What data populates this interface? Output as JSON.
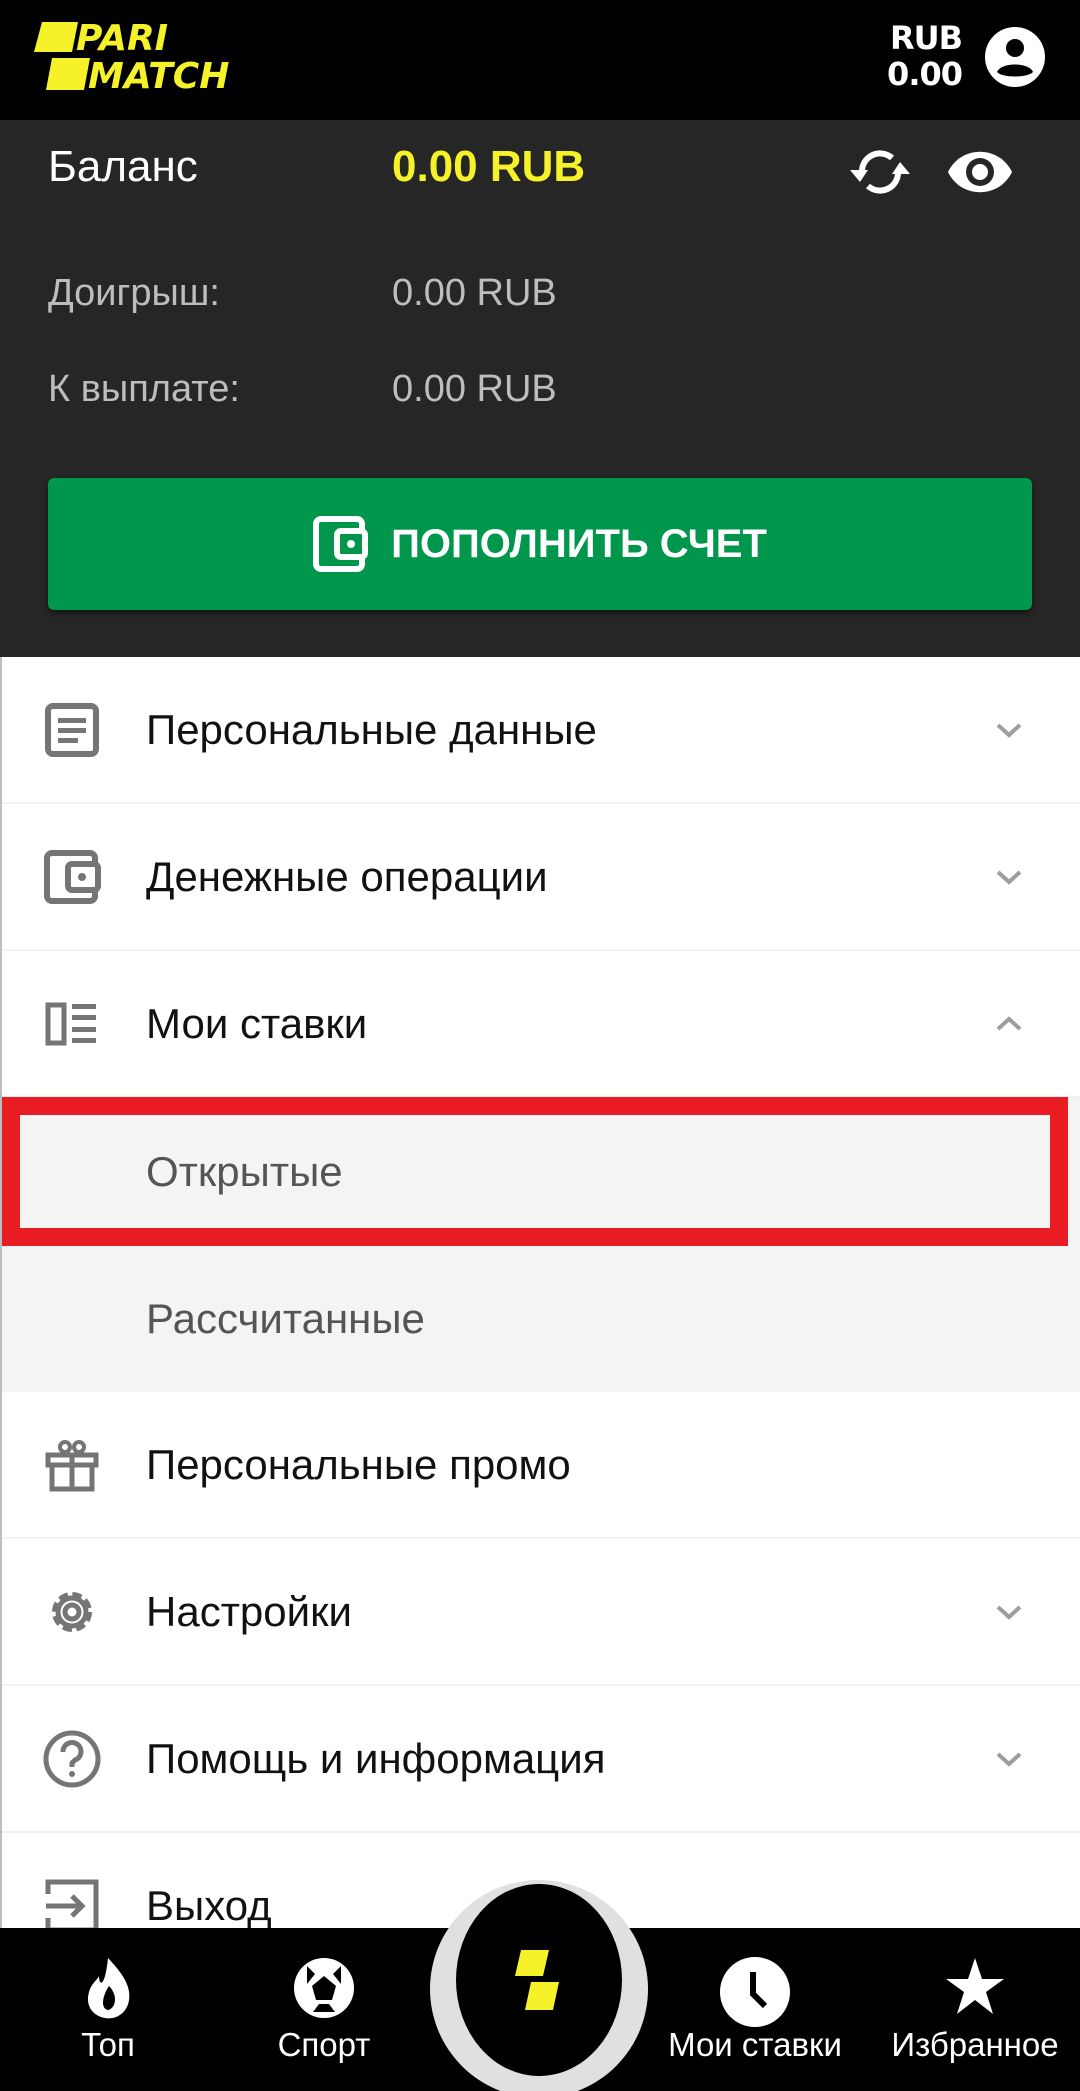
{
  "header": {
    "brand": "PARIMATCH",
    "brand_line1": "PARI",
    "brand_line2": "MATCH",
    "currency": "RUB",
    "amount": "0.00",
    "avatar_icon": "user-circle-icon"
  },
  "balance": {
    "label": "Баланс",
    "value": "0.00 RUB",
    "refresh_icon": "refresh-icon",
    "visibility_icon": "eye-icon",
    "rows": [
      {
        "label": "Доигрыш:",
        "value": "0.00 RUB"
      },
      {
        "label": "К выплате:",
        "value": "0.00 RUB"
      }
    ],
    "deposit_button": "ПОПОЛНИТЬ СЧЕТ"
  },
  "menu": {
    "items": [
      {
        "label": "Персональные данные",
        "icon": "document-icon",
        "chevron": "down"
      },
      {
        "label": "Денежные операции",
        "icon": "wallet-icon",
        "chevron": "down"
      },
      {
        "label": "Мои ставки",
        "icon": "bets-list-icon",
        "chevron": "up"
      },
      {
        "label": "Открытые",
        "sub": true,
        "highlighted": true
      },
      {
        "label": "Рассчитанные",
        "sub": true
      },
      {
        "label": "Персональные промо",
        "icon": "gift-icon"
      },
      {
        "label": "Настройки",
        "icon": "gear-icon",
        "chevron": "down"
      },
      {
        "label": "Помощь и информация",
        "icon": "help-icon",
        "chevron": "down"
      },
      {
        "label": "Выход",
        "icon": "logout-icon"
      }
    ]
  },
  "bottom_nav": {
    "items": [
      {
        "label": "Топ",
        "icon": "flame-icon"
      },
      {
        "label": "Спорт",
        "icon": "soccer-ball-icon"
      },
      {
        "label": "",
        "icon": "parimatch-logo-icon"
      },
      {
        "label": "Мои ставки",
        "icon": "clock-icon"
      },
      {
        "label": "Избранное",
        "icon": "star-icon"
      }
    ]
  },
  "colors": {
    "brand_yellow": "#f6f22a",
    "header_bg": "#000000",
    "panel_bg": "#262626",
    "deposit_green": "#00964c",
    "highlight_red": "#e91c24"
  }
}
